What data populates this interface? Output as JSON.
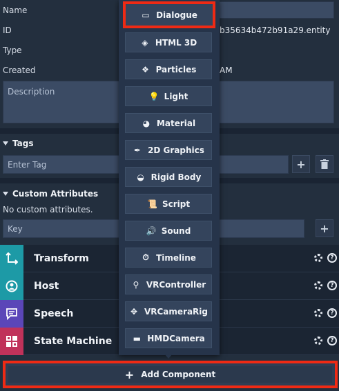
{
  "properties": {
    "name_label": "Name",
    "id_label": "ID",
    "id_value": "b35634b472b91a29.entity",
    "type_label": "Type",
    "created_label": "Created",
    "created_value": "AM",
    "description_placeholder": "Description"
  },
  "tags": {
    "title": "Tags",
    "input_placeholder": "Enter Tag",
    "add_icon": "+",
    "delete_icon": "trash-icon"
  },
  "custom_attributes": {
    "title": "Custom Attributes",
    "empty_text": "No custom attributes.",
    "key_placeholder": "Key",
    "add_icon": "+"
  },
  "components": [
    {
      "name": "Transform",
      "icon": "transform-icon",
      "color": "#1d9aa6"
    },
    {
      "name": "Host",
      "icon": "host-icon",
      "color": "#1d9aa6"
    },
    {
      "name": "Speech",
      "icon": "speech-icon",
      "color": "#5b46b8"
    },
    {
      "name": "State Machine",
      "icon": "state-machine-icon",
      "color": "#c0325a"
    }
  ],
  "component_actions": {
    "gear": "gear-icon",
    "help": "?"
  },
  "dropdown": {
    "items": [
      {
        "label": "Dialogue",
        "icon": "dialogue-icon",
        "glyph": "▭",
        "selected": true
      },
      {
        "label": "HTML 3D",
        "icon": "html3d-icon",
        "glyph": "◈"
      },
      {
        "label": "Particles",
        "icon": "particles-icon",
        "glyph": "❖"
      },
      {
        "label": "Light",
        "icon": "light-icon",
        "glyph": "💡"
      },
      {
        "label": "Material",
        "icon": "material-icon",
        "glyph": "◕"
      },
      {
        "label": "2D Graphics",
        "icon": "pen-icon",
        "glyph": "✒"
      },
      {
        "label": "Rigid Body",
        "icon": "rigid-body-icon",
        "glyph": "◒"
      },
      {
        "label": "Script",
        "icon": "script-icon",
        "glyph": "📜"
      },
      {
        "label": "Sound",
        "icon": "sound-icon",
        "glyph": "🔊"
      },
      {
        "label": "Timeline",
        "icon": "timeline-icon",
        "glyph": "⏱"
      },
      {
        "label": "VRController",
        "icon": "vr-controller-icon",
        "glyph": "⚲"
      },
      {
        "label": "VRCameraRig",
        "icon": "vr-camera-rig-icon",
        "glyph": "✥"
      },
      {
        "label": "HMDCamera",
        "icon": "hmd-camera-icon",
        "glyph": "▬"
      }
    ]
  },
  "footer": {
    "add_component_label": "Add Component",
    "add_icon": "+"
  },
  "colors": {
    "highlight": "#ef2a14",
    "panel": "#232f3e",
    "field": "#3b4b64"
  }
}
